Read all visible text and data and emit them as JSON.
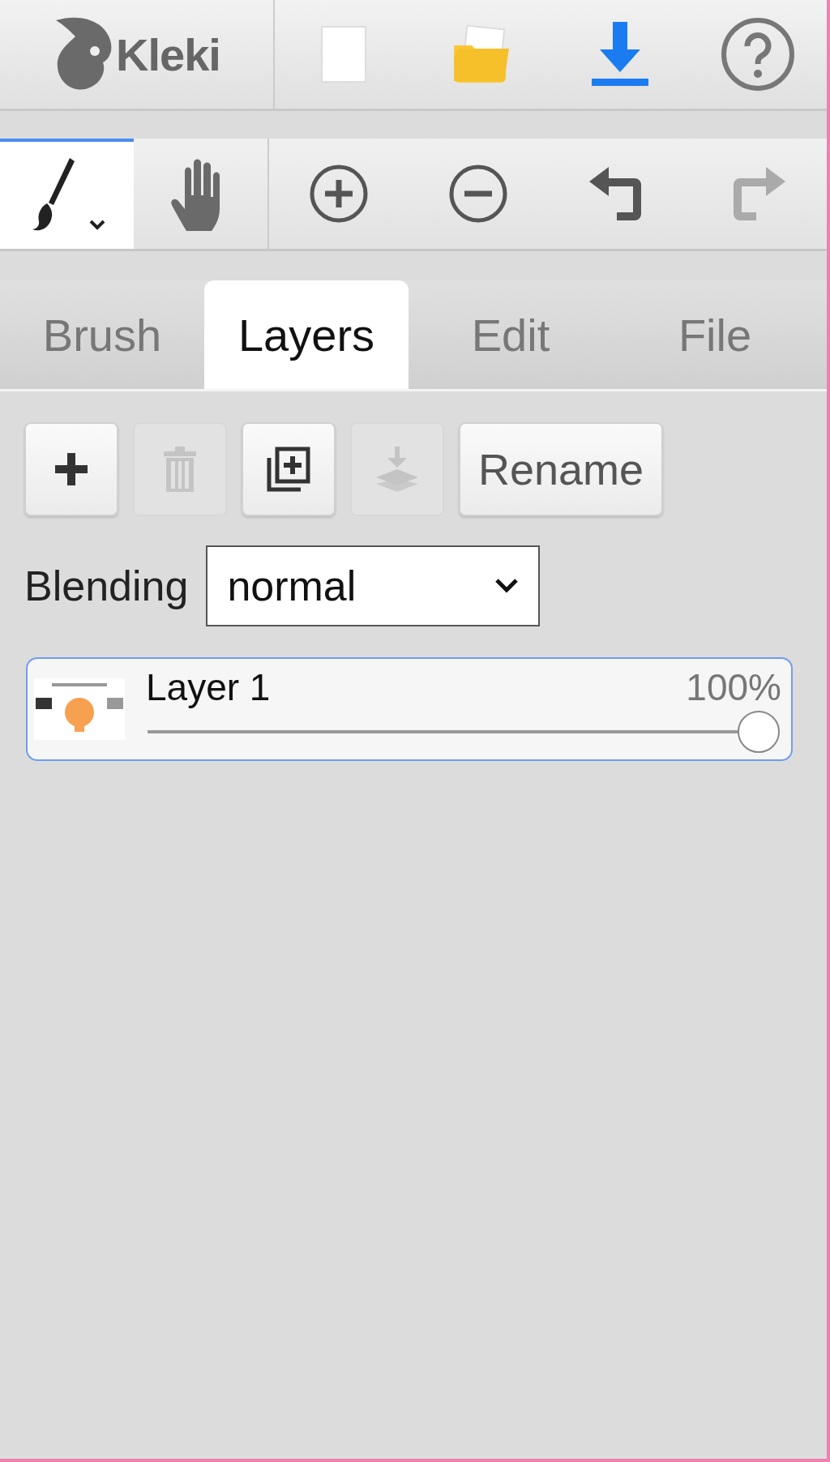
{
  "header": {
    "logo": "Kleki"
  },
  "tools": [
    {
      "kind": "brush",
      "selected": true
    },
    {
      "kind": "hand",
      "selected": false
    }
  ],
  "actions": [
    {
      "kind": "zoom-in",
      "disabled": false
    },
    {
      "kind": "zoom-out",
      "disabled": false
    },
    {
      "kind": "undo",
      "disabled": false
    },
    {
      "kind": "redo",
      "disabled": true
    }
  ],
  "tabs": [
    {
      "label": "Brush",
      "selected": false
    },
    {
      "label": "Layers",
      "selected": true
    },
    {
      "label": "Edit",
      "selected": false
    },
    {
      "label": "File",
      "selected": false
    }
  ],
  "layer_buttons": [
    {
      "kind": "add",
      "disabled": false
    },
    {
      "kind": "delete",
      "disabled": true
    },
    {
      "kind": "duplicate",
      "disabled": false
    },
    {
      "kind": "merge",
      "disabled": true
    },
    {
      "kind": "text",
      "label": "Rename",
      "disabled": false
    }
  ],
  "blending": {
    "label": "Blending",
    "value": "normal"
  },
  "layers": [
    {
      "name": "Layer 1",
      "opacity": "100%",
      "level": 1,
      "selected": true
    }
  ]
}
